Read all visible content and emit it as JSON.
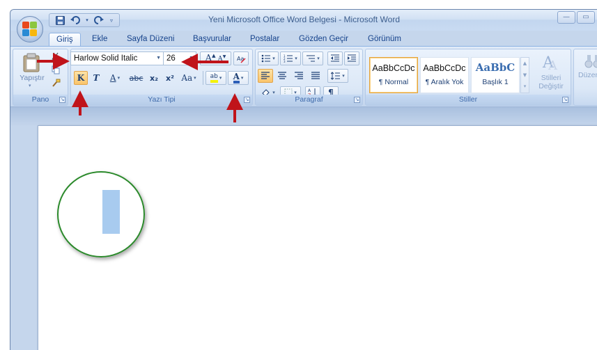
{
  "window": {
    "title": "Yeni Microsoft Office Word Belgesi - Microsoft Word"
  },
  "qat": {
    "save_icon": "save-icon",
    "undo_icon": "undo-icon",
    "redo_icon": "redo-icon",
    "customize_icon": "qat-customize-icon"
  },
  "tabs": [
    {
      "label": "Giriş",
      "active": true
    },
    {
      "label": "Ekle",
      "active": false
    },
    {
      "label": "Sayfa Düzeni",
      "active": false
    },
    {
      "label": "Başvurular",
      "active": false
    },
    {
      "label": "Postalar",
      "active": false
    },
    {
      "label": "Gözden Geçir",
      "active": false
    },
    {
      "label": "Görünüm",
      "active": false
    }
  ],
  "ribbon": {
    "clipboard": {
      "paste_label": "Yapıştır",
      "group_label": "Pano"
    },
    "font": {
      "font_name": "Harlow Solid Italic",
      "font_size": "26",
      "bold_label": "K",
      "italic_label": "T",
      "underline_label": "A",
      "strike_label": "abc",
      "subscript_label": "x₂",
      "superscript_label": "x²",
      "case_label": "Aa",
      "highlight_label": "ab",
      "font_color_label": "A",
      "grow_label": "A",
      "shrink_label": "A",
      "group_label": "Yazı Tipi"
    },
    "paragraph": {
      "group_label": "Paragraf",
      "pilcrow": "¶",
      "sort_label": "A Z"
    },
    "styles": {
      "cards": [
        {
          "sample": "AaBbCcDc",
          "name": "¶ Normal",
          "selected": true
        },
        {
          "sample": "AaBbCcDc",
          "name": "¶ Aralık Yok",
          "selected": false
        },
        {
          "sample": "AaBbC",
          "name": "Başlık 1",
          "selected": false
        }
      ],
      "change_styles_label_1": "Stilleri",
      "change_styles_label_2": "Değiştir",
      "group_label": "Stiller",
      "editing_label": "Düzen"
    }
  },
  "colors": {
    "accent_arrow": "#c0131a",
    "circle": "#2b8a2b",
    "cursor": "#a8cbef",
    "pressed_button": "#f9c46b"
  }
}
